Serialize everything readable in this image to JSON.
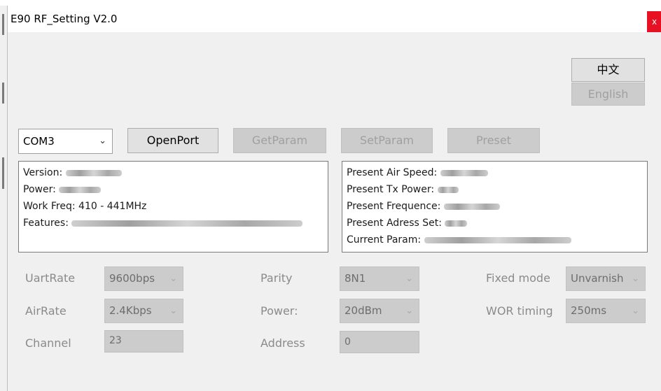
{
  "window": {
    "title": "E90 RF_Setting V2.0",
    "close_glyph": "x"
  },
  "language": {
    "chinese_label": "中文",
    "english_label": "English"
  },
  "port": {
    "selected": "COM3"
  },
  "toolbar": {
    "open_port": "OpenPort",
    "get_param": "GetParam",
    "set_param": "SetParam",
    "preset": "Preset"
  },
  "info_left": {
    "version_label": "Version:",
    "power_label": "Power:",
    "work_freq": "Work Freq: 410 - 441MHz",
    "features_label": "Features:"
  },
  "info_right": {
    "air_speed_label": "Present Air Speed:",
    "tx_power_label": "Present Tx Power:",
    "frequence_label": "Present Frequence:",
    "address_label": "Present Adress Set:",
    "current_param_label": "Current Param:"
  },
  "settings": {
    "uart_rate_label": "UartRate",
    "uart_rate_value": "9600bps",
    "parity_label": "Parity",
    "parity_value": "8N1",
    "fixed_mode_label": "Fixed mode",
    "fixed_mode_value": "Unvarnish",
    "air_rate_label": "AirRate",
    "air_rate_value": "2.4Kbps",
    "power_label": "Power:",
    "power_value": "20dBm",
    "wor_timing_label": "WOR timing",
    "wor_timing_value": "250ms",
    "channel_label": "Channel",
    "channel_value": "23",
    "address_label": "Address",
    "address_value": "0"
  },
  "colors": {
    "close_button": "#e81123",
    "window_bg": "#f0f0f0",
    "disabled_bg": "#cccccc"
  }
}
